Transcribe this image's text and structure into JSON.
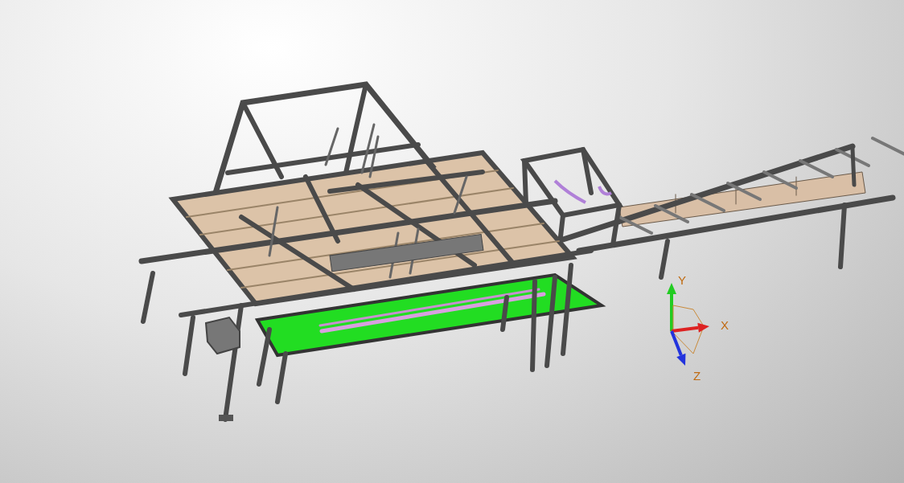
{
  "viewport": {
    "axes": [
      {
        "label": "Y",
        "color": "#22cc22"
      },
      {
        "label": "X",
        "color": "#dd2222"
      },
      {
        "label": "Z",
        "color": "#2233dd"
      }
    ]
  }
}
